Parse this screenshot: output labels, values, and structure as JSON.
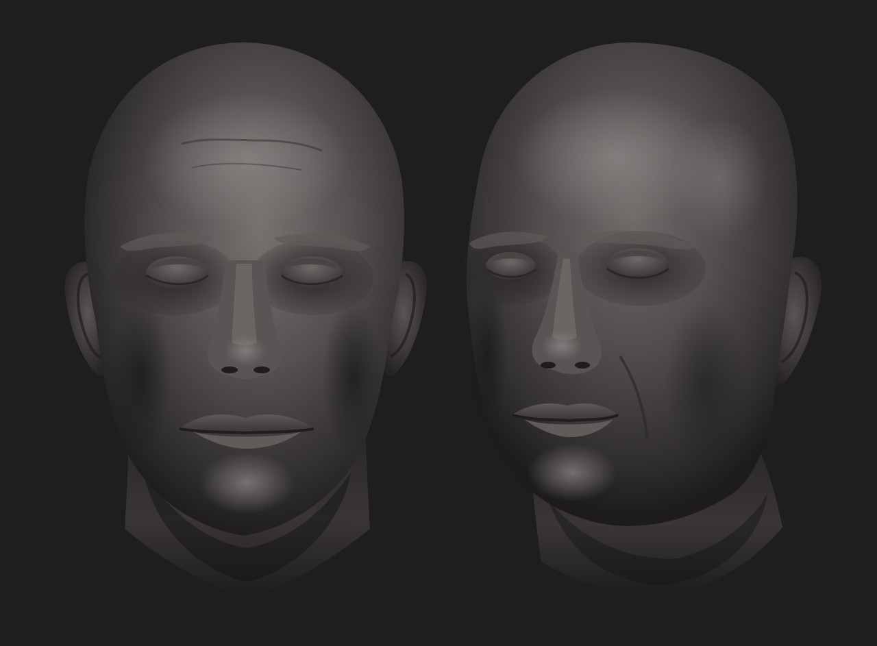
{
  "colors": {
    "background": "#1e1d1f",
    "clay_light": "#7a7474",
    "clay_mid": "#4d4949",
    "clay_dark": "#262425",
    "shadow": "#141314"
  }
}
